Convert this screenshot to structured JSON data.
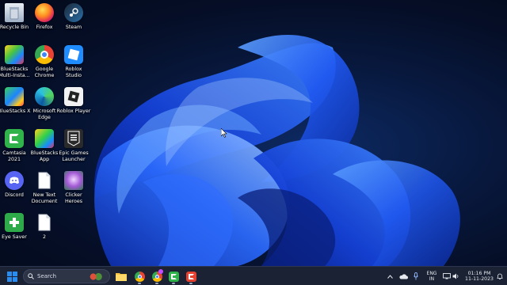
{
  "desktop": {
    "icons": [
      {
        "label": "Recycle Bin",
        "icon": "recycle-bin-icon"
      },
      {
        "label": "Firefox",
        "icon": "firefox-icon"
      },
      {
        "label": "Steam",
        "icon": "steam-icon"
      },
      {
        "label": "BlueStacks\nMulti-Insta...",
        "icon": "bluestacks-multi-instance-icon"
      },
      {
        "label": "Google\nChrome",
        "icon": "chrome-icon"
      },
      {
        "label": "Roblox\nStudio",
        "icon": "roblox-studio-icon"
      },
      {
        "label": "BlueStacks X",
        "icon": "bluestacks-x-icon"
      },
      {
        "label": "Microsoft\nEdge",
        "icon": "edge-icon"
      },
      {
        "label": "Roblox Player",
        "icon": "roblox-player-icon"
      },
      {
        "label": "Camtasia\n2021",
        "icon": "camtasia-icon"
      },
      {
        "label": "BlueStacks\nApp",
        "icon": "bluestacks-app-icon"
      },
      {
        "label": "Epic Games\nLauncher",
        "icon": "epic-games-icon"
      },
      {
        "label": "Discord",
        "icon": "discord-icon"
      },
      {
        "label": "New Text\nDocument",
        "icon": "text-document-icon"
      },
      {
        "label": "Clicker\nHeroes",
        "icon": "clicker-heroes-icon"
      },
      {
        "label": "Eye Saver",
        "icon": "eye-saver-icon"
      },
      {
        "label": "2",
        "icon": "blank-file-icon"
      }
    ]
  },
  "taskbar": {
    "search_placeholder": "Search",
    "apps": [
      "file-explorer-icon",
      "chrome-icon",
      "chrome-profile-icon",
      "camtasia-icon",
      "camtasia-recorder-icon"
    ],
    "tray": {
      "lang_line1": "ENG",
      "lang_line2": "IN",
      "time": "01:16 PM",
      "date": "11-11-2023"
    }
  },
  "colors": {
    "taskbar_bg": "#1a2233",
    "wallpaper_accent": "#1e5bff",
    "windows_blue": "#2b8cf0"
  }
}
